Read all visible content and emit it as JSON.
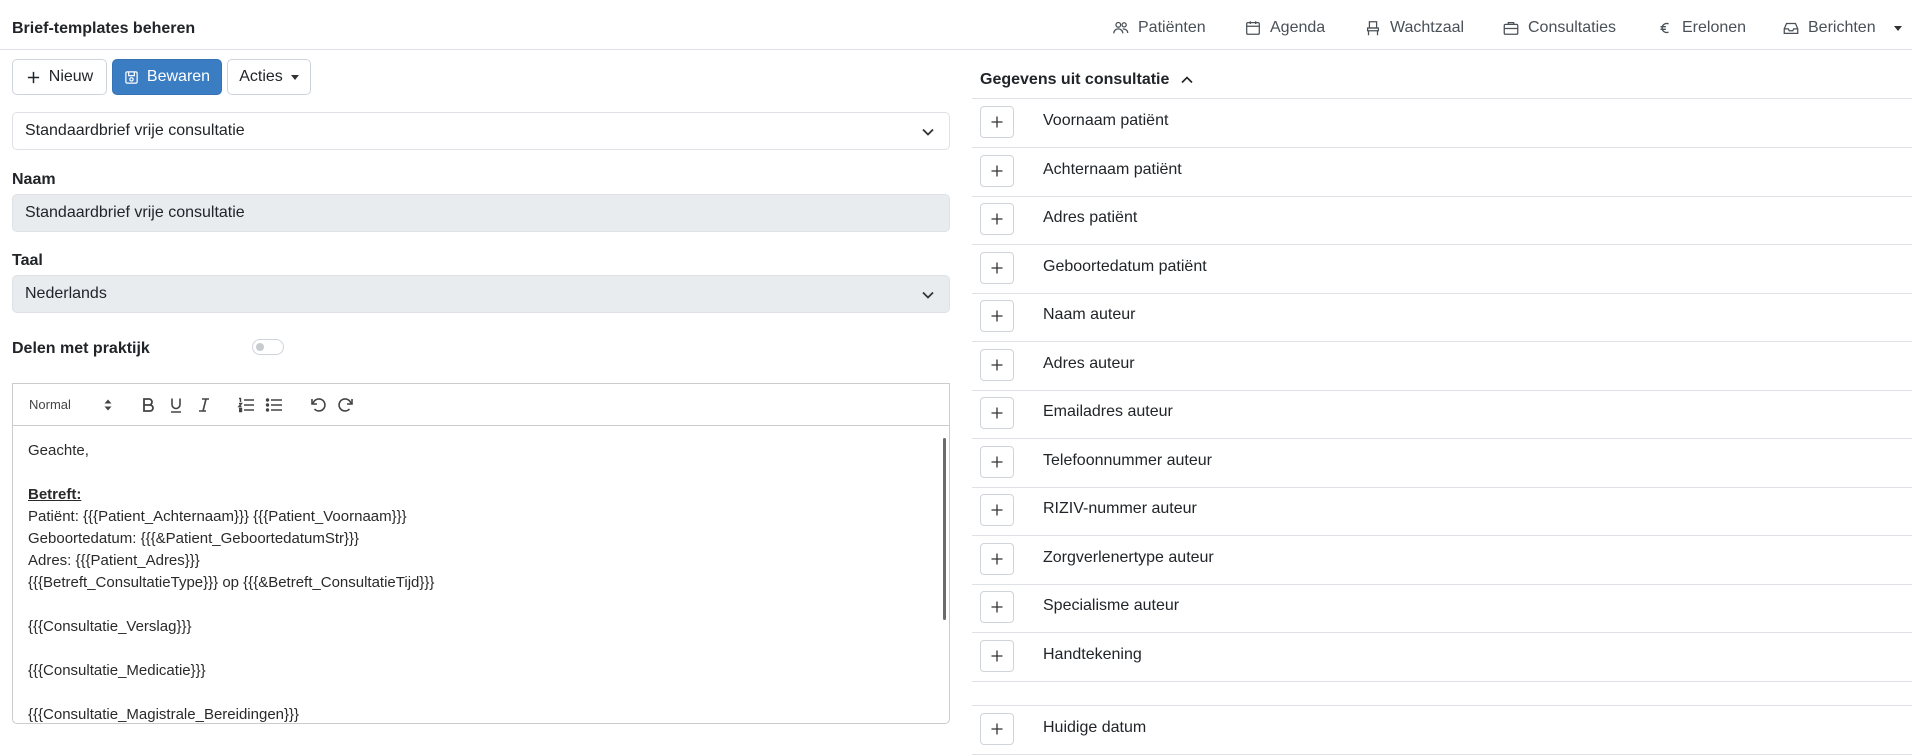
{
  "header": {
    "title": "Brief-templates beheren",
    "nav": [
      {
        "label": "Patiënten",
        "icon": "people-icon"
      },
      {
        "label": "Agenda",
        "icon": "calendar-icon"
      },
      {
        "label": "Wachtzaal",
        "icon": "chair-icon"
      },
      {
        "label": "Consultaties",
        "icon": "briefcase-icon"
      },
      {
        "label": "Erelonen",
        "icon": "euro-icon"
      },
      {
        "label": "Berichten",
        "icon": "inbox-icon"
      }
    ]
  },
  "toolbar": {
    "new_label": "Nieuw",
    "save_label": "Bewaren",
    "actions_label": "Acties"
  },
  "form": {
    "template_select": "Standaardbrief vrije consultatie",
    "name_label": "Naam",
    "name_value": "Standaardbrief vrije consultatie",
    "language_label": "Taal",
    "language_value": "Nederlands",
    "share_label": "Delen met praktijk",
    "share_enabled": false
  },
  "editor": {
    "format_value": "Normal",
    "lines": [
      "Geachte,",
      "",
      "Betreft:",
      "Patiënt: {{{Patient_Achternaam}}} {{{Patient_Voornaam}}}",
      "Geboortedatum: {{{&Patient_GeboortedatumStr}}}",
      "Adres: {{{Patient_Adres}}}",
      "{{{Betreft_ConsultatieType}}} op {{{&Betreft_ConsultatieTijd}}}",
      "",
      "{{{Consultatie_Verslag}}}",
      "",
      "{{{Consultatie_Medicatie}}}",
      "",
      "{{{Consultatie_Magistrale_Bereidingen}}}"
    ]
  },
  "panel": {
    "title": "Gegevens uit consultatie",
    "fields": [
      "Voornaam patiënt",
      "Achternaam patiënt",
      "Adres patiënt",
      "Geboortedatum patiënt",
      "Naam auteur",
      "Adres auteur",
      "Emailadres auteur",
      "Telefoonnummer auteur",
      "RIZIV-nummer auteur",
      "Zorgverlenertype auteur",
      "Specialisme auteur",
      "Handtekening"
    ],
    "extra_fields": [
      "Huidige datum"
    ]
  },
  "colors": {
    "primary": "#3b7dc3",
    "border": "#dee2e6",
    "disabled_bg": "#e9ecef"
  }
}
